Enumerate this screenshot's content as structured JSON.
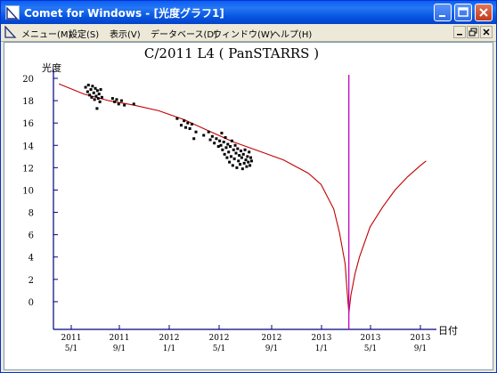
{
  "window": {
    "title": "Comet for Windows - [光度グラフ1]"
  },
  "menubar": {
    "items": [
      "メニュー(M)",
      "設定(S)",
      "表示(V)",
      "データベース(D)",
      "ウィンドウ(W)",
      "ヘルプ(H)"
    ]
  },
  "chart_data": {
    "type": "scatter",
    "title": "C/2011 L4 ( PanSTARRS )",
    "ylabel": "光度",
    "xlabel": "日付",
    "ylim": [
      20,
      -2
    ],
    "y_inverted": true,
    "yticks": [
      0,
      2,
      4,
      6,
      8,
      10,
      12,
      14,
      16,
      18,
      20
    ],
    "xticks": [
      {
        "year": "2011",
        "date": "5/1"
      },
      {
        "year": "2011",
        "date": "9/1"
      },
      {
        "year": "2012",
        "date": "1/1"
      },
      {
        "year": "2012",
        "date": "5/1"
      },
      {
        "year": "2012",
        "date": "9/1"
      },
      {
        "year": "2013",
        "date": "1/1"
      },
      {
        "year": "2013",
        "date": "5/1"
      },
      {
        "year": "2013",
        "date": "9/1"
      }
    ],
    "perihelion_marker": {
      "date": "2013-03-10",
      "color": "#c000c0"
    },
    "curve": {
      "color": "#c00000",
      "points": [
        [
          "2011-04-01",
          19.5
        ],
        [
          "2011-06-01",
          18.6
        ],
        [
          "2011-08-01",
          18.0
        ],
        [
          "2011-10-01",
          17.6
        ],
        [
          "2011-12-01",
          17.1
        ],
        [
          "2012-02-01",
          16.3
        ],
        [
          "2012-04-01",
          15.3
        ],
        [
          "2012-06-01",
          14.3
        ],
        [
          "2012-08-01",
          13.5
        ],
        [
          "2012-10-01",
          12.7
        ],
        [
          "2012-12-01",
          11.5
        ],
        [
          "2013-01-01",
          10.5
        ],
        [
          "2013-02-01",
          8.3
        ],
        [
          "2013-02-15",
          6.2
        ],
        [
          "2013-03-01",
          3.4
        ],
        [
          "2013-03-05",
          1.3
        ],
        [
          "2013-03-10",
          -1.0
        ],
        [
          "2013-03-15",
          0.6
        ],
        [
          "2013-03-25",
          2.5
        ],
        [
          "2013-04-05",
          4.0
        ],
        [
          "2013-05-01",
          6.7
        ],
        [
          "2013-06-01",
          8.5
        ],
        [
          "2013-07-01",
          10.0
        ],
        [
          "2013-08-01",
          11.2
        ],
        [
          "2013-09-01",
          12.2
        ],
        [
          "2013-09-15",
          12.6
        ]
      ]
    },
    "observations": {
      "color": "#000000",
      "points": [
        [
          "2011-06-05",
          19.2
        ],
        [
          "2011-06-10",
          18.8
        ],
        [
          "2011-06-12",
          19.4
        ],
        [
          "2011-06-15",
          18.5
        ],
        [
          "2011-06-18",
          19.0
        ],
        [
          "2011-06-20",
          18.3
        ],
        [
          "2011-06-22",
          19.3
        ],
        [
          "2011-06-25",
          18.7
        ],
        [
          "2011-06-27",
          18.1
        ],
        [
          "2011-06-29",
          19.1
        ],
        [
          "2011-07-01",
          18.4
        ],
        [
          "2011-07-03",
          17.3
        ],
        [
          "2011-07-04",
          18.9
        ],
        [
          "2011-07-06",
          18.2
        ],
        [
          "2011-07-08",
          18.6
        ],
        [
          "2011-07-10",
          17.9
        ],
        [
          "2011-07-12",
          19.0
        ],
        [
          "2011-07-15",
          18.3
        ],
        [
          "2011-08-10",
          18.2
        ],
        [
          "2011-08-15",
          17.9
        ],
        [
          "2011-08-20",
          18.1
        ],
        [
          "2011-08-25",
          17.7
        ],
        [
          "2011-09-01",
          18.0
        ],
        [
          "2011-09-08",
          17.6
        ],
        [
          "2011-10-01",
          17.7
        ],
        [
          "2012-01-15",
          16.4
        ],
        [
          "2012-01-25",
          15.8
        ],
        [
          "2012-02-01",
          16.2
        ],
        [
          "2012-02-05",
          15.6
        ],
        [
          "2012-02-10",
          16.0
        ],
        [
          "2012-02-15",
          15.5
        ],
        [
          "2012-02-20",
          15.9
        ],
        [
          "2012-02-25",
          14.6
        ],
        [
          "2012-03-01",
          15.2
        ],
        [
          "2012-03-20",
          14.9
        ],
        [
          "2012-04-01",
          15.2
        ],
        [
          "2012-04-05",
          14.5
        ],
        [
          "2012-04-10",
          14.8
        ],
        [
          "2012-04-15",
          14.2
        ],
        [
          "2012-04-20",
          14.6
        ],
        [
          "2012-04-25",
          13.9
        ],
        [
          "2012-04-28",
          14.4
        ],
        [
          "2012-05-01",
          14.0
        ],
        [
          "2012-05-03",
          15.1
        ],
        [
          "2012-05-05",
          13.6
        ],
        [
          "2012-05-08",
          14.3
        ],
        [
          "2012-05-10",
          13.2
        ],
        [
          "2012-05-12",
          14.7
        ],
        [
          "2012-05-14",
          13.8
        ],
        [
          "2012-05-16",
          12.9
        ],
        [
          "2012-05-18",
          14.1
        ],
        [
          "2012-05-20",
          13.4
        ],
        [
          "2012-05-22",
          12.5
        ],
        [
          "2012-05-24",
          13.9
        ],
        [
          "2012-05-26",
          13.0
        ],
        [
          "2012-05-28",
          14.4
        ],
        [
          "2012-05-30",
          12.2
        ],
        [
          "2012-06-01",
          13.6
        ],
        [
          "2012-06-03",
          12.8
        ],
        [
          "2012-06-05",
          14.0
        ],
        [
          "2012-06-07",
          13.3
        ],
        [
          "2012-06-09",
          12.0
        ],
        [
          "2012-06-11",
          13.7
        ],
        [
          "2012-06-13",
          12.6
        ],
        [
          "2012-06-15",
          13.1
        ],
        [
          "2012-06-17",
          12.3
        ],
        [
          "2012-06-19",
          13.5
        ],
        [
          "2012-06-21",
          12.9
        ],
        [
          "2012-06-23",
          11.9
        ],
        [
          "2012-06-25",
          13.2
        ],
        [
          "2012-06-27",
          12.4
        ],
        [
          "2012-06-29",
          13.6
        ],
        [
          "2012-07-01",
          12.7
        ],
        [
          "2012-07-03",
          12.1
        ],
        [
          "2012-07-05",
          13.0
        ],
        [
          "2012-07-07",
          12.5
        ],
        [
          "2012-07-09",
          13.4
        ],
        [
          "2012-07-11",
          12.2
        ],
        [
          "2012-07-13",
          12.9
        ],
        [
          "2012-07-15",
          12.6
        ]
      ]
    }
  }
}
